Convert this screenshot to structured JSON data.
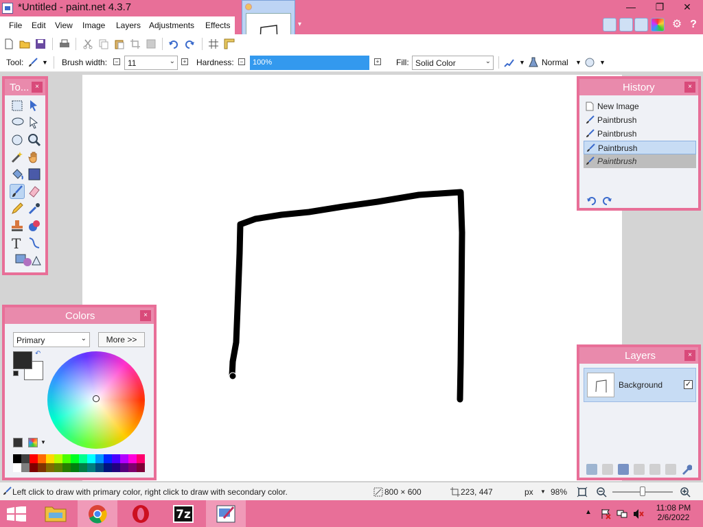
{
  "window": {
    "title": "*Untitled - paint.net 4.3.7",
    "minimize": "—",
    "restore": "❐",
    "close": "✕"
  },
  "menu": [
    "File",
    "Edit",
    "View",
    "Image",
    "Layers",
    "Adjustments",
    "Effects"
  ],
  "toolbar": {
    "tool_label": "Tool:",
    "brush_width_label": "Brush width:",
    "brush_width_value": "11",
    "hardness_label": "Hardness:",
    "hardness_value": "100%",
    "fill_label": "Fill:",
    "fill_value": "Solid Color",
    "blend_mode": "Normal"
  },
  "tools_panel": {
    "title": "To...",
    "close": "×"
  },
  "colors_panel": {
    "title": "Colors",
    "close": "×",
    "mode_select": "Primary",
    "more_button": "More >>",
    "palette": [
      "#000000",
      "#404040",
      "#ff0000",
      "#ff6a00",
      "#ffd800",
      "#b6ff00",
      "#4cff00",
      "#00ff21",
      "#00ff90",
      "#00ffff",
      "#0094ff",
      "#0026ff",
      "#4800ff",
      "#b200ff",
      "#ff00dc",
      "#ff006e",
      "#ffffff",
      "#808080",
      "#7f0000",
      "#7f3300",
      "#7f6a00",
      "#5b7f00",
      "#267f00",
      "#007f0e",
      "#007f46",
      "#007f7f",
      "#004a7f",
      "#00137f",
      "#21007f",
      "#57007f",
      "#7f006e",
      "#7f0037"
    ]
  },
  "history_panel": {
    "title": "History",
    "close": "×",
    "items": [
      {
        "label": "New Image",
        "state": "normal"
      },
      {
        "label": "Paintbrush",
        "state": "normal"
      },
      {
        "label": "Paintbrush",
        "state": "normal"
      },
      {
        "label": "Paintbrush",
        "state": "selected"
      },
      {
        "label": "Paintbrush",
        "state": "undone"
      }
    ]
  },
  "layers_panel": {
    "title": "Layers",
    "close": "×",
    "layer_name": "Background",
    "visible_check": "✓"
  },
  "status": {
    "hint": "Left click to draw with primary color, right click to draw with secondary color.",
    "image_size": "800 × 600",
    "cursor_pos": "223, 447",
    "unit": "px",
    "zoom": "98%"
  },
  "taskbar": {
    "time": "11:08 PM",
    "date": "2/6/2022"
  }
}
